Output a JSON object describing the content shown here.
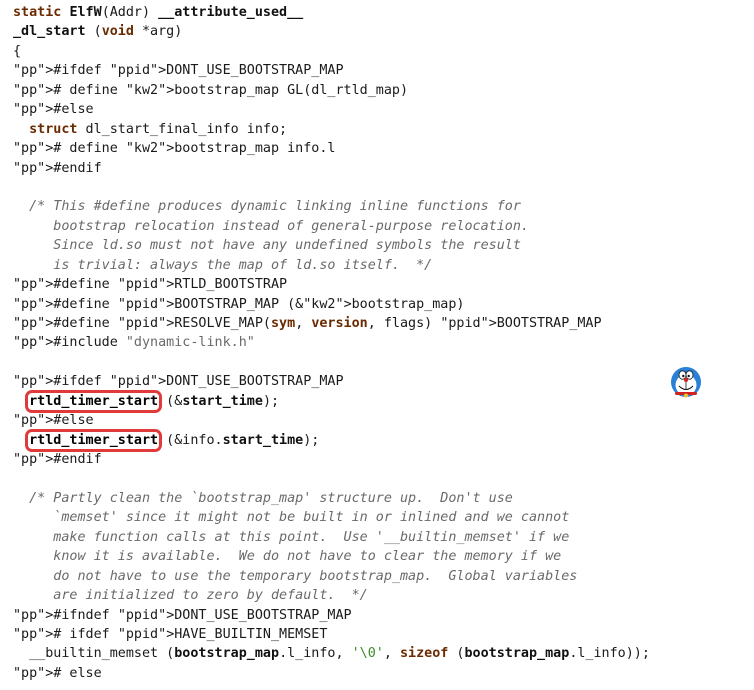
{
  "lines": [
    {
      "t": "static ElfW(Addr) __attribute_used__"
    },
    {
      "t": "_dl_start (void *arg)"
    },
    {
      "t": "{"
    },
    {
      "t": "#ifdef DONT_USE_BOOTSTRAP_MAP"
    },
    {
      "t": "# define bootstrap_map GL(dl_rtld_map)"
    },
    {
      "t": "#else"
    },
    {
      "t": "  struct dl_start_final_info info;"
    },
    {
      "t": "# define bootstrap_map info.l"
    },
    {
      "t": "#endif"
    },
    {
      "t": ""
    },
    {
      "t": "  /* This #define produces dynamic linking inline functions for"
    },
    {
      "t": "     bootstrap relocation instead of general-purpose relocation."
    },
    {
      "t": "     Since ld.so must not have any undefined symbols the result"
    },
    {
      "t": "     is trivial: always the map of ld.so itself.  */"
    },
    {
      "t": "#define RTLD_BOOTSTRAP"
    },
    {
      "t": "#define BOOTSTRAP_MAP (&bootstrap_map)"
    },
    {
      "t": "#define RESOLVE_MAP(sym, version, flags) BOOTSTRAP_MAP"
    },
    {
      "t": "#include \"dynamic-link.h\""
    },
    {
      "t": ""
    },
    {
      "t": "#ifdef DONT_USE_BOOTSTRAP_MAP"
    },
    {
      "t": "  rtld_timer_start (&start_time);"
    },
    {
      "t": "#else"
    },
    {
      "t": "  rtld_timer_start (&info.start_time);"
    },
    {
      "t": "#endif"
    },
    {
      "t": ""
    },
    {
      "t": "  /* Partly clean the `bootstrap_map' structure up.  Don't use"
    },
    {
      "t": "     `memset' since it might not be built in or inlined and we cannot"
    },
    {
      "t": "     make function calls at this point.  Use '__builtin_memset' if we"
    },
    {
      "t": "     know it is available.  We do not have to clear the memory if we"
    },
    {
      "t": "     do not have to use the temporary bootstrap_map.  Global variables"
    },
    {
      "t": "     are initialized to zero by default.  */"
    },
    {
      "t": "#ifndef DONT_USE_BOOTSTRAP_MAP"
    },
    {
      "t": "# ifdef HAVE_BUILTIN_MEMSET"
    },
    {
      "t": "  __builtin_memset (bootstrap_map.l_info, '\\0', sizeof (bootstrap_map.l_info));"
    },
    {
      "t": "# else"
    }
  ],
  "highlighted_calls": [
    "rtld_timer_start",
    "rtld_timer_start"
  ],
  "colors": {
    "highlight_border": "#e03a3a",
    "keyword": "#6b2b00",
    "preprocessor": "#4a6a8a",
    "macro": "#3565a8",
    "comment": "#6a6a6a"
  },
  "mascot_icon": "doraemon-mascot-icon"
}
